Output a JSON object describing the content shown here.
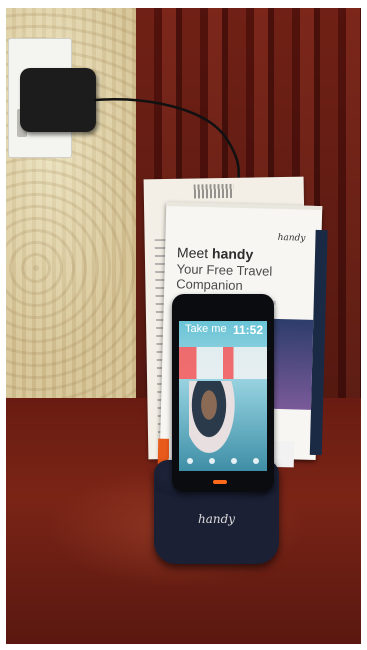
{
  "photo": {
    "brochure": {
      "logo_text": "handy",
      "headline_prefix": "Meet",
      "headline_brand": "handy",
      "subtitle_line1": "Your Free Travel",
      "subtitle_line2": "Companion"
    },
    "phone_screen": {
      "title": "Take me",
      "time": "11:52"
    },
    "dock": {
      "label": "handy"
    }
  },
  "colors": {
    "curtain": "#6a1d14",
    "wallpaper": "#d4c295",
    "dock": "#1b2034",
    "accent_orange": "#ff6a1a"
  }
}
